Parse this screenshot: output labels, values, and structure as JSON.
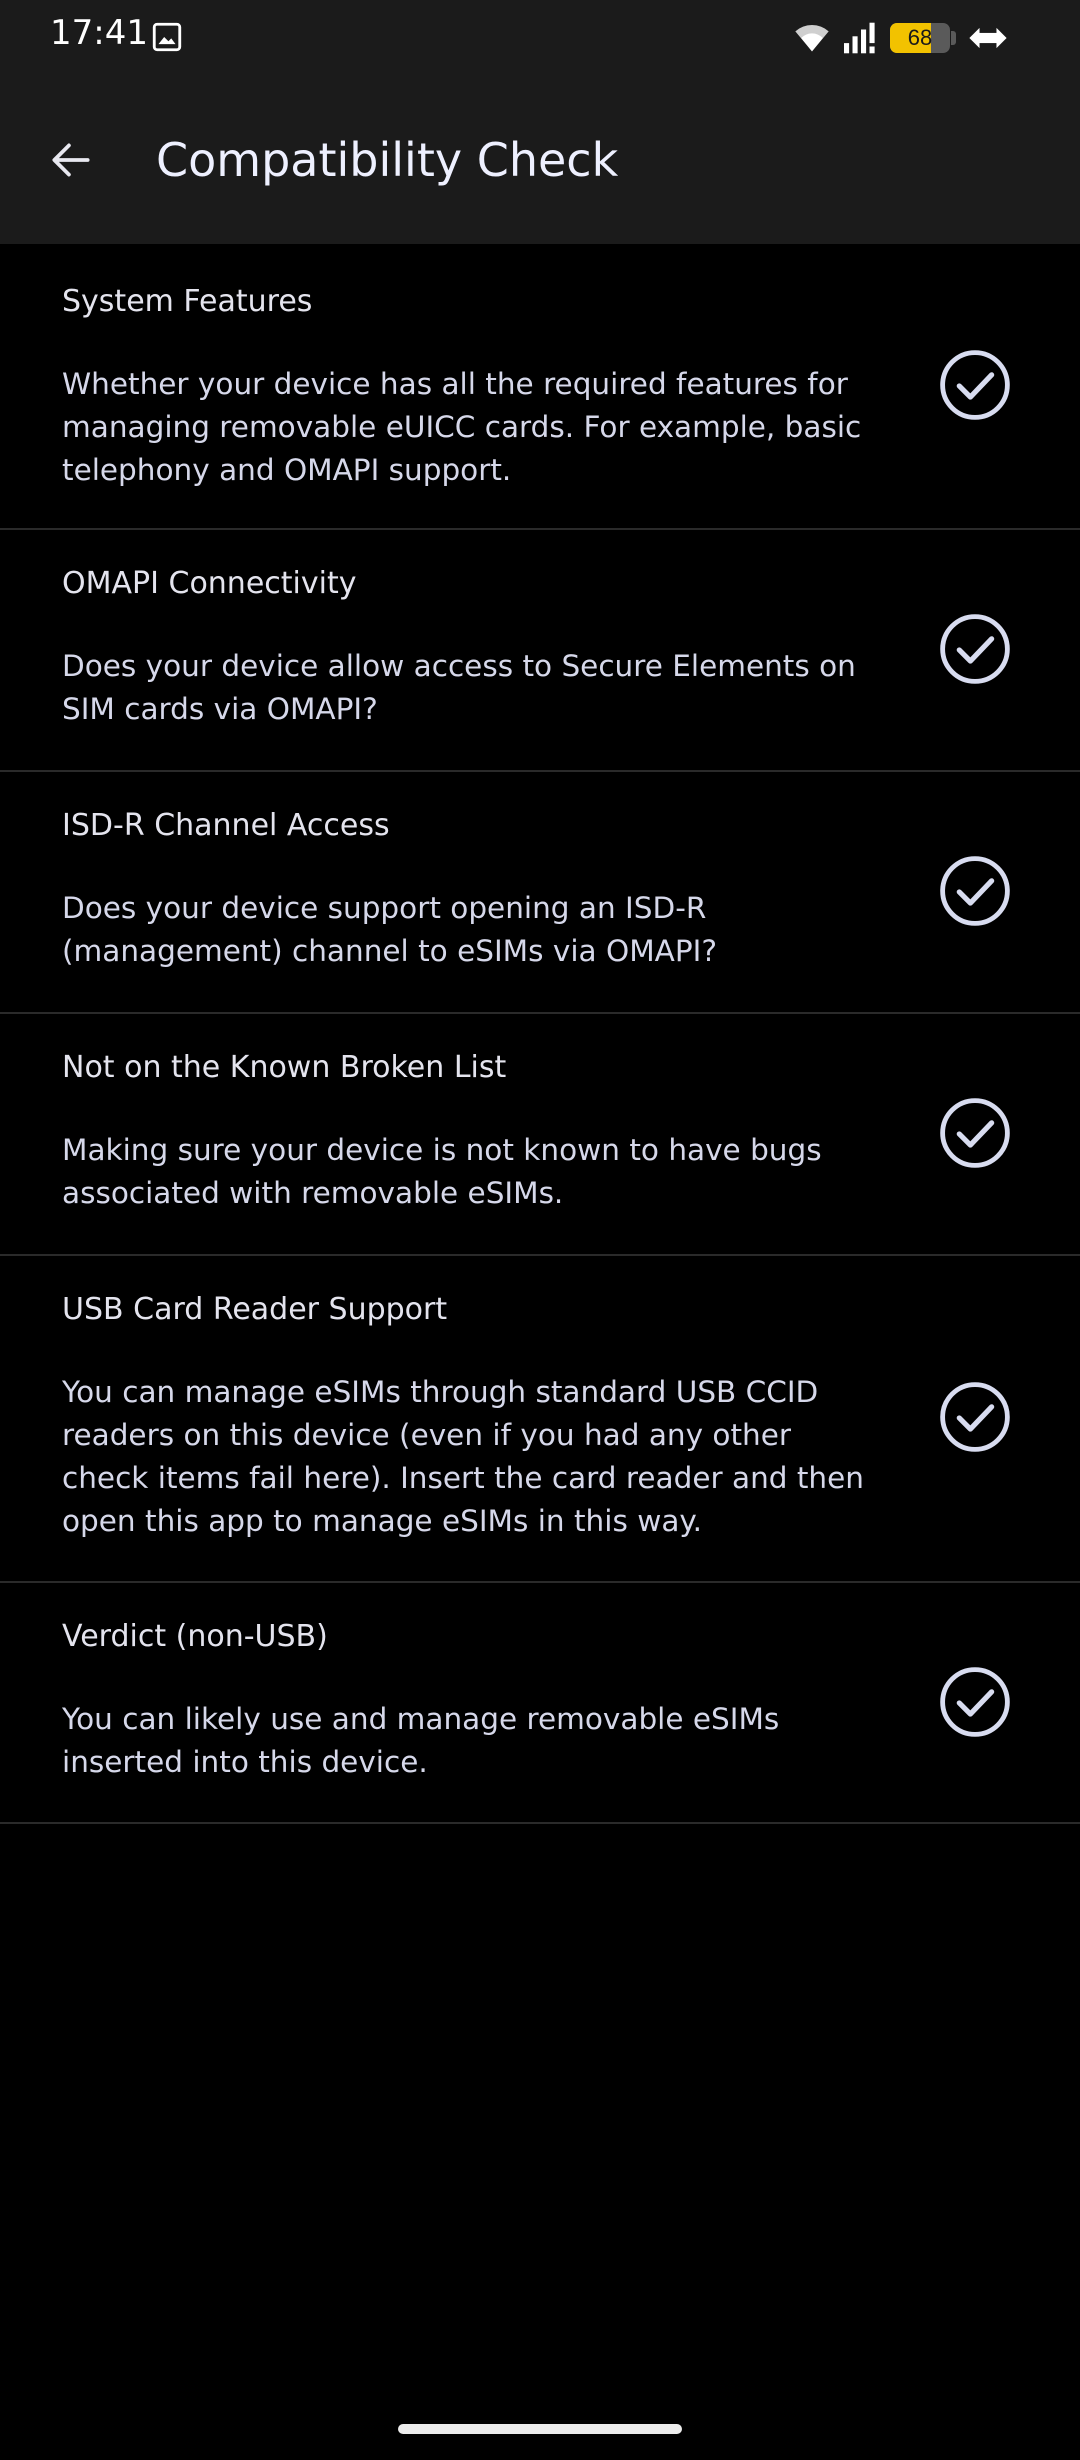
{
  "status_bar": {
    "time": "17:41",
    "battery_level": 68,
    "battery_text": "68",
    "icons": [
      "image-icon",
      "wifi-icon",
      "signal-icon",
      "battery-icon",
      "link-icon"
    ]
  },
  "app_bar": {
    "title": "Compatibility Check",
    "back_icon": "arrow-left-icon"
  },
  "checks": [
    {
      "title": "System Features",
      "description": "Whether your device has all the required features for managing removable eUICC cards. For example, basic telephony and OMAPI support.",
      "status": "passed"
    },
    {
      "title": "OMAPI Connectivity",
      "description": "Does your device allow access to Secure Elements on SIM cards via OMAPI?",
      "status": "passed"
    },
    {
      "title": "ISD-R Channel Access",
      "description": "Does your device support opening an ISD-R (management) channel to eSIMs via OMAPI?",
      "status": "passed"
    },
    {
      "title": "Not on the Known Broken List",
      "description": "Making sure your device is not known to have bugs associated with removable eSIMs.",
      "status": "passed"
    },
    {
      "title": "USB Card Reader Support",
      "description": "You can manage eSIMs through standard USB CCID readers on this device (even if you had any other check items fail here). Insert the card reader and then open this app to manage eSIMs in this way.",
      "status": "passed"
    },
    {
      "title": "Verdict (non-USB)",
      "description": "You can likely use and manage removable eSIMs inserted into this device.",
      "status": "passed"
    }
  ],
  "colors": {
    "background": "#000000",
    "app_bar": "#1b1b1b",
    "divider": "#2a2a2a",
    "battery": "#f2c200",
    "check_icon": "#d8dcf0"
  }
}
